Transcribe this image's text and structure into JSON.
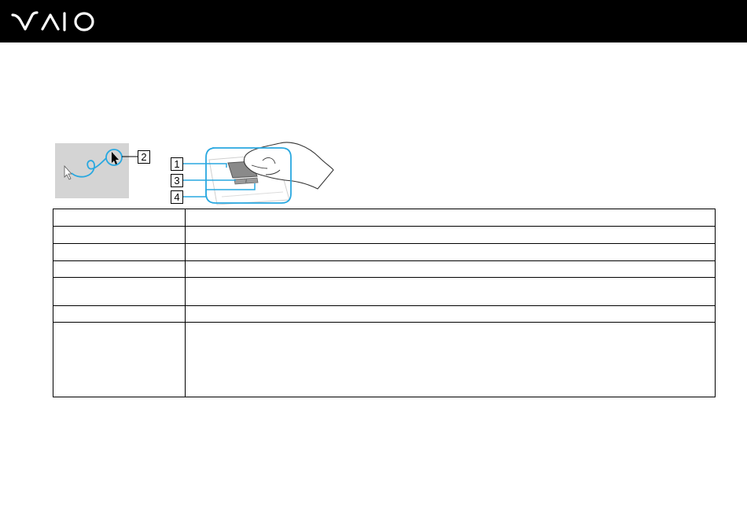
{
  "header": {
    "brand_logo": "VAIO",
    "background_color": "#000000",
    "logo_color": "#ffffff"
  },
  "illustration": {
    "accent_color": "#29a8e0",
    "panel_color": "#d4d4d4",
    "callouts": [
      "1",
      "2",
      "3",
      "4"
    ]
  },
  "table": {
    "rows": [
      {
        "c1": "",
        "c2": ""
      },
      {
        "c1": "",
        "c2": ""
      },
      {
        "c1": "",
        "c2": ""
      },
      {
        "c1": "",
        "c2": ""
      },
      {
        "c1": "",
        "c2": ""
      },
      {
        "c1": "",
        "c2": ""
      },
      {
        "c1": "",
        "c2": ""
      }
    ]
  }
}
